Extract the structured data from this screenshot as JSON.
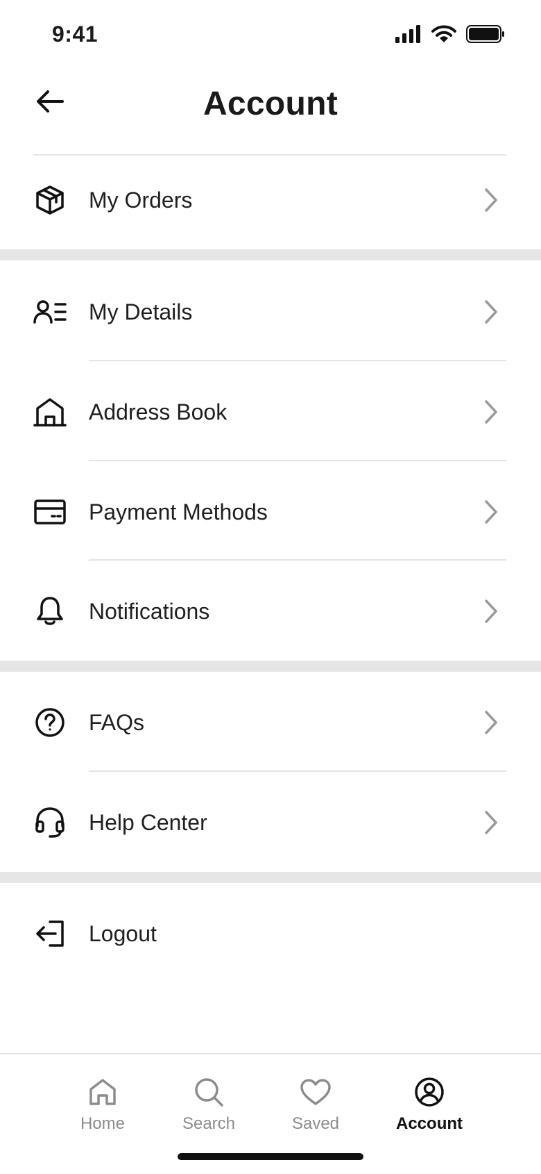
{
  "status": {
    "time": "9:41"
  },
  "header": {
    "title": "Account"
  },
  "menu": {
    "orders": "My Orders",
    "details": "My Details",
    "address": "Address Book",
    "payment": "Payment Methods",
    "notifications": "Notifications",
    "faqs": "FAQs",
    "help": "Help Center",
    "logout": "Logout"
  },
  "nav": {
    "home": "Home",
    "search": "Search",
    "saved": "Saved",
    "account": "Account",
    "active": "account"
  },
  "colors": {
    "text": "#1a1a1a",
    "muted": "#8c8c8c",
    "divider": "#e4e4e4",
    "section_gap": "#e6e6e6",
    "chevron": "#9a9a9a"
  }
}
